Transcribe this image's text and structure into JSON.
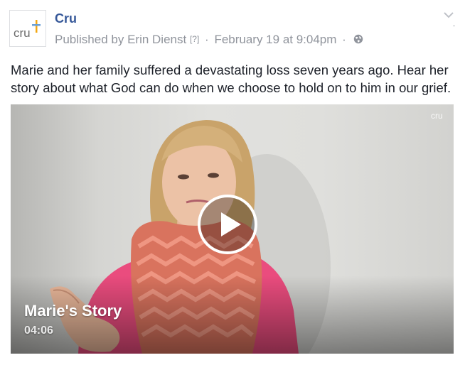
{
  "page": {
    "name": "Cru",
    "avatar_logo_text": "cru"
  },
  "meta": {
    "published_by": "Published by Erin Dienst",
    "help": "[?]",
    "separator": "·",
    "date": "February 19 at 9:04pm",
    "audience_icon": "globe-icon"
  },
  "post": {
    "text": "Marie and her family suffered a devastating loss seven years ago. Hear her story about what God can do when we choose to hold on to him in our grief."
  },
  "video": {
    "title": "Marie's Story",
    "duration": "04:06",
    "watermark": "cru",
    "play_icon": "play-icon"
  },
  "colors": {
    "link": "#365899",
    "meta": "#90949c",
    "text": "#1d2129",
    "brand_orange": "#f3a712",
    "brand_blue": "#6a9fd4"
  }
}
